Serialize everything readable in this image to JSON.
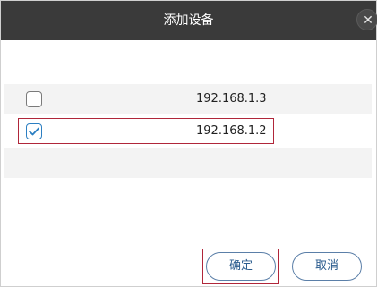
{
  "dialog": {
    "title": "添加设备",
    "close_glyph": "✕"
  },
  "devices": [
    {
      "ip": "192.168.1.3",
      "checked": false
    },
    {
      "ip": "192.168.1.2",
      "checked": true
    }
  ],
  "buttons": {
    "confirm_label": "确定",
    "cancel_label": "取消"
  },
  "colors": {
    "titlebar": "#3a3a3a",
    "row_background": "#f3f3f3",
    "highlight_border": "#b0263a",
    "checkbox_accent": "#2c7fc2",
    "button_border": "#5b7fa8"
  }
}
